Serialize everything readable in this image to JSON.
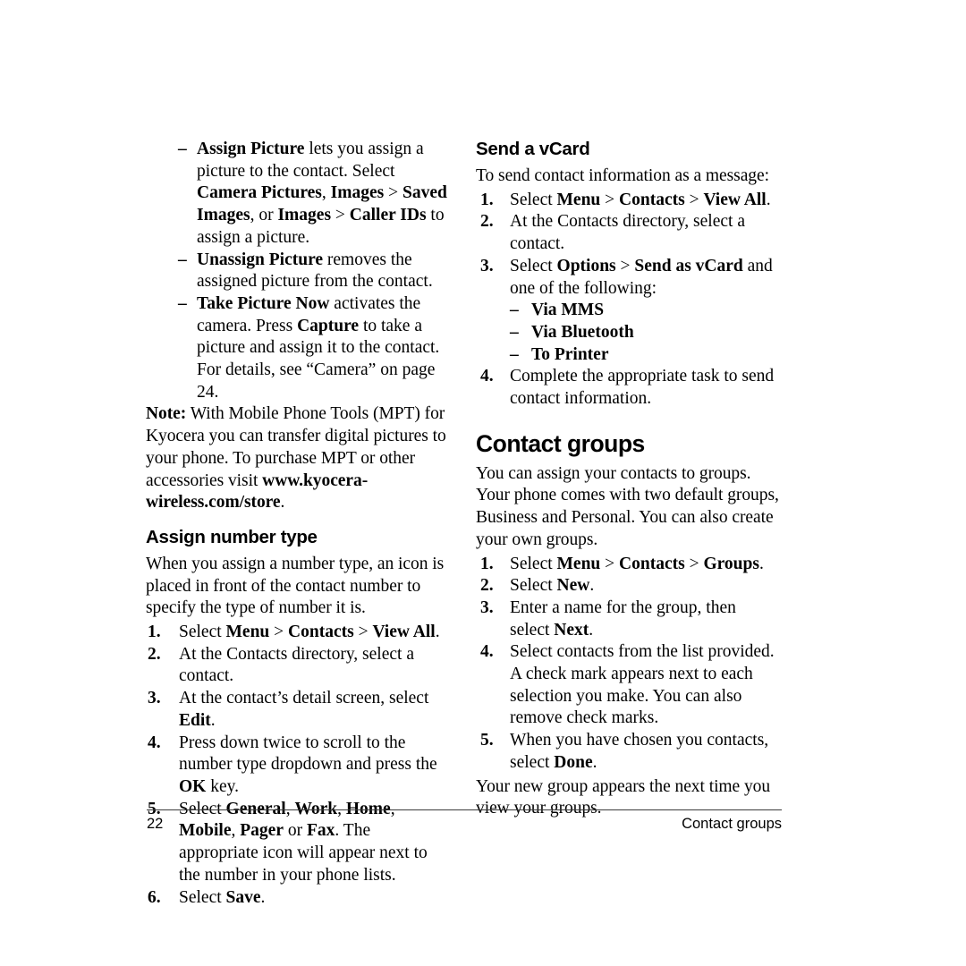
{
  "document": {
    "page_number": "22",
    "running_head": "Contact groups"
  },
  "left_column": {
    "picture_options": [
      {
        "dash": "–",
        "html": "<b>Assign Picture</b> lets you assign a picture to the contact. Select <b>Camera Pictures</b>, <b>Images</b> &gt; <b>Saved Images</b>, or <b>Images</b> &gt; <b>Caller IDs</b> to assign a picture."
      },
      {
        "dash": "–",
        "html": "<b>Unassign Picture</b> removes the assigned picture from the contact."
      },
      {
        "dash": "–",
        "html": "<b>Take Picture Now</b> activates the camera. Press <b>Capture</b> to take a picture and assign it to the contact. For details, see “Camera” on page 24."
      }
    ],
    "note_html": "<b>Note:</b> With Mobile Phone Tools (MPT) for Kyocera you can transfer digital pictures to your phone. To purchase MPT or other accessories visit <b>www.kyocera-wireless.com/store</b>.",
    "assign_number_type_heading": "Assign number type",
    "assign_number_type_intro": "When you assign a number type, an icon is placed in front of the contact number to specify the type of number it is.",
    "assign_number_type_steps": [
      {
        "num": "1.",
        "html": "Select <b>Menu</b> &gt; <b>Contacts</b> &gt; <b>View All</b>."
      },
      {
        "num": "2.",
        "html": "At the Contacts directory, select a contact."
      },
      {
        "num": "3.",
        "html": "At the contact’s detail screen, select <b>Edit</b>."
      },
      {
        "num": "4.",
        "html": "Press down twice to scroll to the number type dropdown and press the <b>OK</b> key."
      },
      {
        "num": "5.",
        "html": "Select <b>General</b>, <b>Work</b>, <b>Home</b>, <b>Mobile</b>, <b>Pager</b> or <b>Fax</b>. The appropriate icon will appear next to the number in your phone lists."
      },
      {
        "num": "6.",
        "html": "Select <b>Save</b>."
      }
    ]
  },
  "right_column": {
    "send_vcard_heading": "Send a vCard",
    "send_vcard_intro": "To send contact information as a message:",
    "send_vcard_steps_before": [
      {
        "num": "1.",
        "html": "Select <b>Menu</b> &gt; <b>Contacts</b> &gt; <b>View All</b>."
      },
      {
        "num": "2.",
        "html": "At the Contacts directory, select a contact."
      },
      {
        "num": "3.",
        "html": "Select <b>Options</b> &gt; <b>Send as vCard</b> and one of the following:"
      }
    ],
    "send_vcard_suboptions": [
      {
        "dash": "–",
        "html": "Via MMS"
      },
      {
        "dash": "–",
        "html": "Via Bluetooth"
      },
      {
        "dash": "–",
        "html": "To Printer"
      }
    ],
    "send_vcard_steps_after": [
      {
        "num": "4.",
        "html": "Complete the appropriate task to send contact information."
      }
    ],
    "contact_groups_heading": "Contact groups",
    "contact_groups_intro": "You can assign your contacts to groups. Your phone comes with two default groups, Business and Personal. You can also create your own groups.",
    "contact_groups_steps": [
      {
        "num": "1.",
        "html": "Select <b>Menu</b> &gt; <b>Contacts</b> &gt; <b>Groups</b>."
      },
      {
        "num": "2.",
        "html": "Select <b>New</b>."
      },
      {
        "num": "3.",
        "html": "Enter a name for the group, then select <b>Next</b>."
      },
      {
        "num": "4.",
        "html": "Select contacts from the list provided. A check mark appears next to each selection you make. You can also remove check marks."
      },
      {
        "num": "5.",
        "html": "When you have chosen you contacts, select <b>Done</b>."
      }
    ],
    "contact_groups_outro": "Your new group appears the next time you view your groups."
  }
}
